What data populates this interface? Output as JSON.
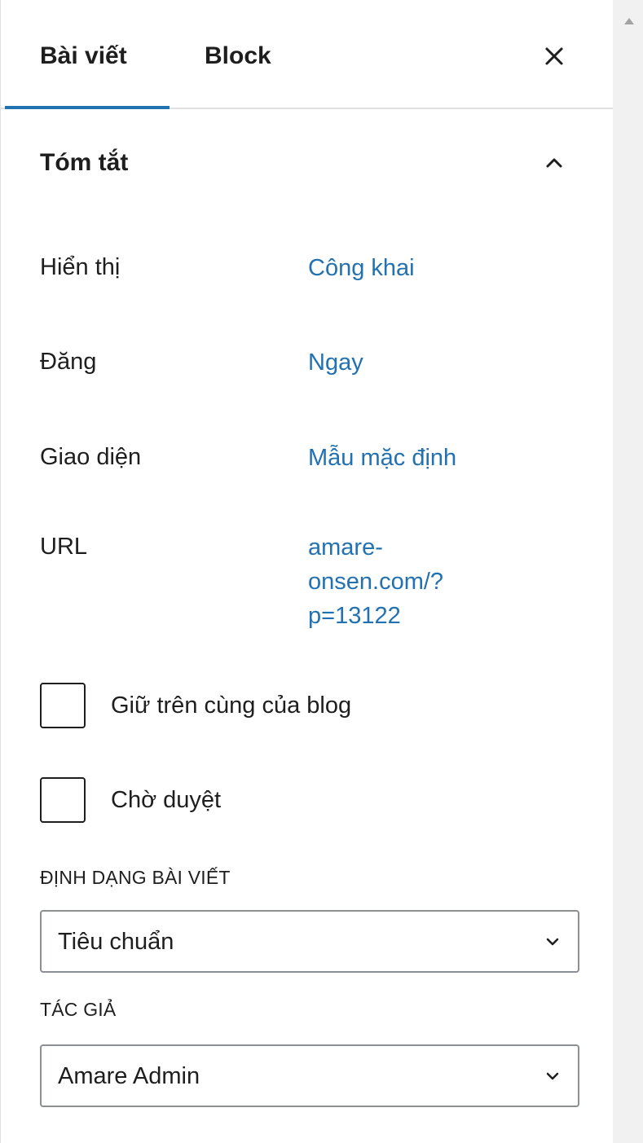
{
  "tabs": {
    "post": "Bài viết",
    "block": "Block",
    "active": "post"
  },
  "summary": {
    "title": "Tóm tắt",
    "rows": [
      {
        "label": "Hiển thị",
        "value": "Công khai"
      },
      {
        "label": "Đăng",
        "value": "Ngay"
      },
      {
        "label": "Giao diện",
        "value": "Mẫu mặc định"
      },
      {
        "label": "URL",
        "value_lines": [
          "amare-",
          "onsen.com/?",
          "p=13122"
        ]
      }
    ],
    "checkboxes": [
      {
        "label": "Giữ trên cùng của blog",
        "checked": false
      },
      {
        "label": "Chờ duyệt",
        "checked": false
      }
    ],
    "post_format": {
      "label": "ĐỊNH DẠNG BÀI VIẾT",
      "value": "Tiêu chuẩn"
    },
    "author": {
      "label": "TÁC GIẢ",
      "value": "Amare Admin"
    }
  },
  "colors": {
    "accent": "#2271b1",
    "text": "#1e1e1e",
    "border": "#e0e0e0"
  },
  "icons": {
    "close": "close-icon",
    "collapse": "chevron-up-icon",
    "select": "chevron-down-icon"
  }
}
